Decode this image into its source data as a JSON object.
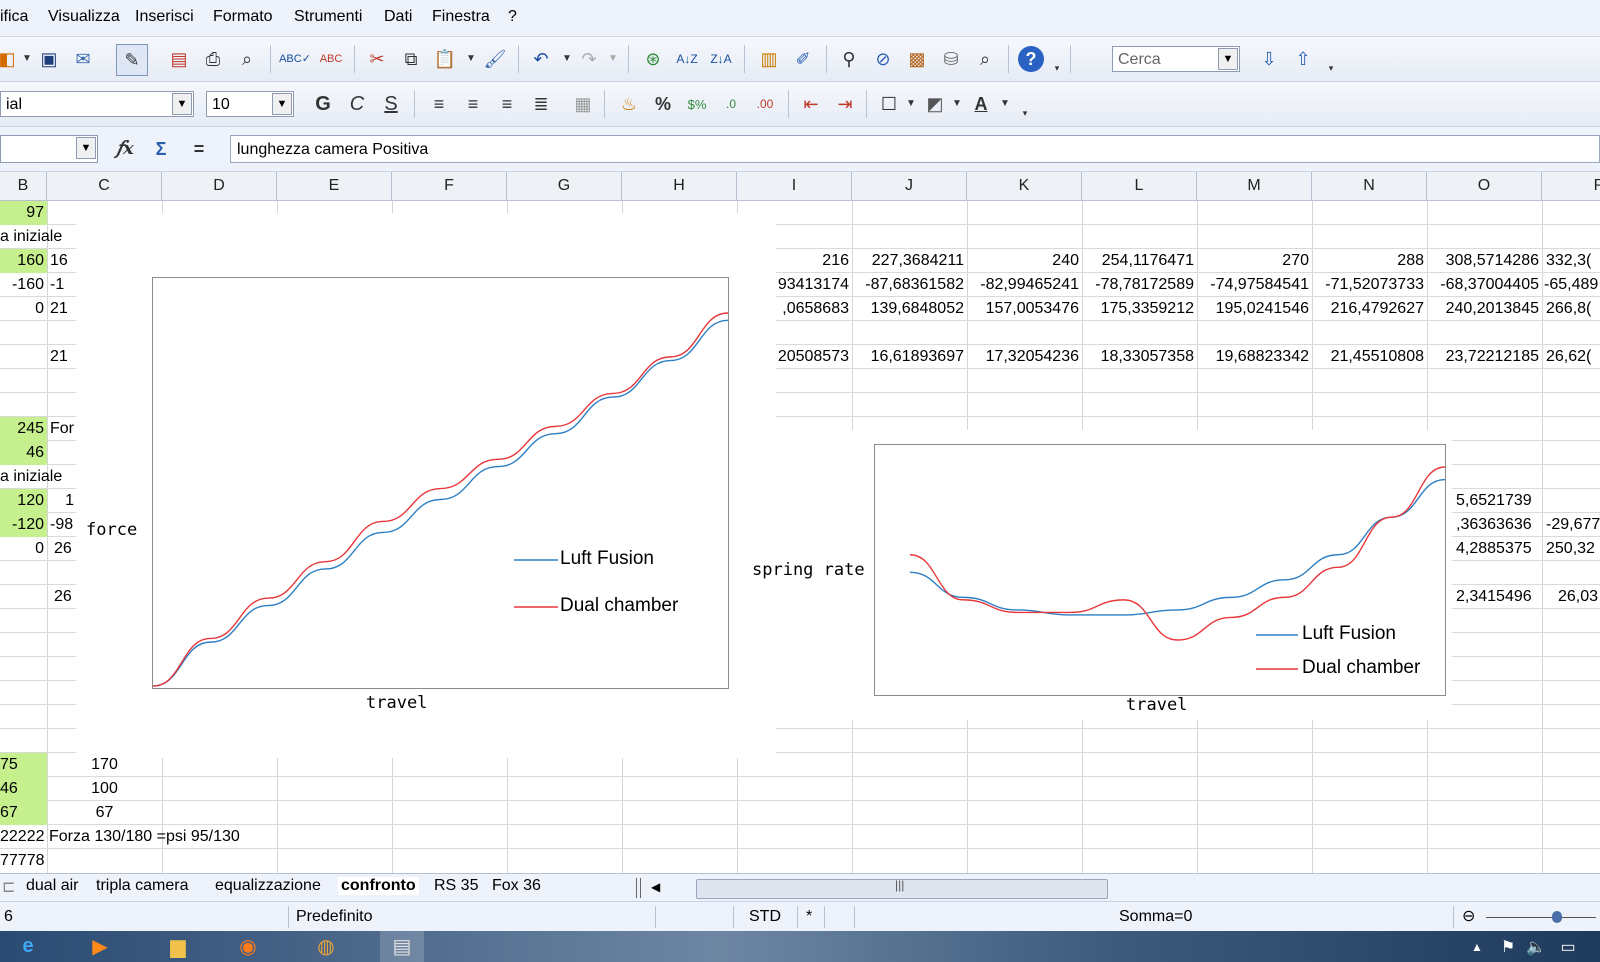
{
  "menubar": {
    "items": [
      "ifica",
      "Visualizza",
      "Inserisci",
      "Formato",
      "Strumenti",
      "Dati",
      "Finestra",
      "?"
    ]
  },
  "toolbar": {
    "search_value": "Cerca",
    "font_name": "ial",
    "font_size": "10",
    "bold": "G",
    "italic": "C",
    "underline": "S"
  },
  "formula_bar": {
    "name_box": "",
    "fx": "𝑓x",
    "sum": "Σ",
    "equals": "=",
    "content": "lunghezza camera Positiva"
  },
  "columns": [
    "B",
    "C",
    "D",
    "E",
    "F",
    "G",
    "H",
    "I",
    "J",
    "K",
    "L",
    "M",
    "N",
    "O",
    "P"
  ],
  "cells": {
    "b_col": [
      "97",
      "a iniziale",
      "160",
      "-160",
      "0",
      "245",
      "46",
      "a iniziale",
      "120",
      "-120",
      "0",
      "75",
      "46",
      "67",
      "22222",
      "77778"
    ],
    "c_col": [
      "16",
      "-1",
      "21",
      "21",
      "For",
      "1",
      "-98",
      "26",
      "26",
      "170",
      "100",
      "67",
      "Forza 130/180 =psi 95/130"
    ],
    "row3_right": [
      "216",
      "227,3684211",
      "240",
      "254,1176471",
      "270",
      "288",
      "308,5714286",
      "332,3("
    ],
    "row4_right": [
      "93413174",
      "-87,68361582",
      "-82,99465241",
      "-78,78172589",
      "-74,97584541",
      "-71,52073733",
      "-68,37004405",
      "-65,489"
    ],
    "row5_right": [
      ",0658683",
      "139,6848052",
      "157,0053476",
      "175,3359212",
      "195,0241546",
      "216,4792627",
      "240,2013845",
      "266,8("
    ],
    "row7_right": [
      "20508573",
      "16,61893697",
      "17,32054236",
      "18,33057358",
      "19,68823342",
      "21,45510808",
      "23,72212185",
      "26,62("
    ],
    "o_lower": [
      "5,6521739",
      ",36363636",
      "4,2885375",
      "2,3415496"
    ],
    "p_lower": [
      "-29,677",
      "250,32",
      "26,03"
    ]
  },
  "chart_data": [
    {
      "type": "line",
      "title": "",
      "xlabel": "travel",
      "ylabel": "force",
      "legend_position": "right",
      "grid": false,
      "series": [
        {
          "name": "Luft Fusion",
          "color": "#2e7fc4",
          "x": [
            0,
            0.1,
            0.2,
            0.3,
            0.4,
            0.5,
            0.6,
            0.7,
            0.8,
            0.9,
            1.0
          ],
          "y": [
            0,
            0.12,
            0.22,
            0.32,
            0.42,
            0.51,
            0.6,
            0.69,
            0.79,
            0.89,
            1.0
          ]
        },
        {
          "name": "Dual chamber",
          "color": "#e8373a",
          "x": [
            0,
            0.1,
            0.2,
            0.3,
            0.4,
            0.5,
            0.6,
            0.7,
            0.8,
            0.9,
            1.0
          ],
          "y": [
            0,
            0.13,
            0.24,
            0.34,
            0.45,
            0.54,
            0.62,
            0.71,
            0.8,
            0.9,
            1.02
          ]
        }
      ]
    },
    {
      "type": "line",
      "title": "",
      "xlabel": "travel",
      "ylabel": "spring rate",
      "legend_position": "bottom-right",
      "grid": false,
      "series": [
        {
          "name": "Luft Fusion",
          "color": "#2e7fc4",
          "x": [
            0,
            0.1,
            0.2,
            0.3,
            0.4,
            0.5,
            0.6,
            0.7,
            0.8,
            0.9,
            1.0
          ],
          "y": [
            0.58,
            0.48,
            0.43,
            0.41,
            0.41,
            0.43,
            0.48,
            0.55,
            0.65,
            0.8,
            0.95
          ]
        },
        {
          "name": "Dual chamber",
          "color": "#e8373a",
          "x": [
            0,
            0.1,
            0.2,
            0.3,
            0.4,
            0.5,
            0.6,
            0.7,
            0.8,
            0.9,
            1.0
          ],
          "y": [
            0.65,
            0.47,
            0.42,
            0.42,
            0.47,
            0.31,
            0.4,
            0.48,
            0.6,
            0.8,
            1.0
          ]
        }
      ]
    }
  ],
  "sheet_tabs": [
    "dual air",
    "tripla camera",
    "equalizzazione",
    "confronto",
    "RS 35",
    "Fox 36"
  ],
  "active_tab": "confronto",
  "status": {
    "page": "6",
    "style": "Predefinito",
    "mode": "STD",
    "modified": "*",
    "sum": "Somma=0"
  }
}
